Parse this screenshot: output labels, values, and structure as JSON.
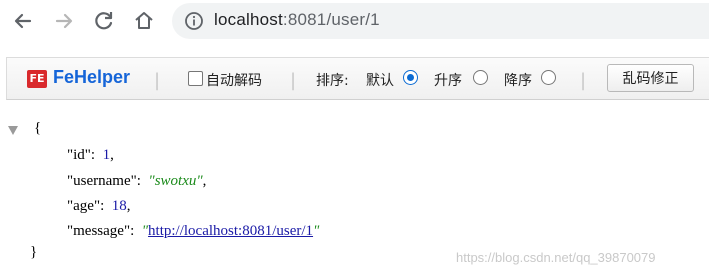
{
  "browser": {
    "url_host": "localhost",
    "url_rest": ":8081/user/1"
  },
  "fehelper": {
    "logo_text": "FE",
    "title": "FeHelper",
    "separator": "|",
    "auto_decode_label": "自动解码",
    "sort_label": "排序:",
    "sort_default_label": "默认",
    "sort_asc_label": "升序",
    "sort_desc_label": "降序",
    "fix_button_label": "乱码修正",
    "sort_selected": "默认"
  },
  "json_view": {
    "open_brace": "{",
    "close_brace": "}",
    "fields": [
      {
        "key": "\"id\"",
        "value": "1",
        "type": "number"
      },
      {
        "key": "\"username\"",
        "value": "\"swotxu\"",
        "type": "string"
      },
      {
        "key": "\"age\"",
        "value": "18",
        "type": "number"
      },
      {
        "key": "\"message\"",
        "value": "http://localhost:8081/user/1",
        "type": "url"
      }
    ],
    "colon": ":",
    "comma": ","
  },
  "watermark": "https://blog.csdn.net/qq_39870079"
}
